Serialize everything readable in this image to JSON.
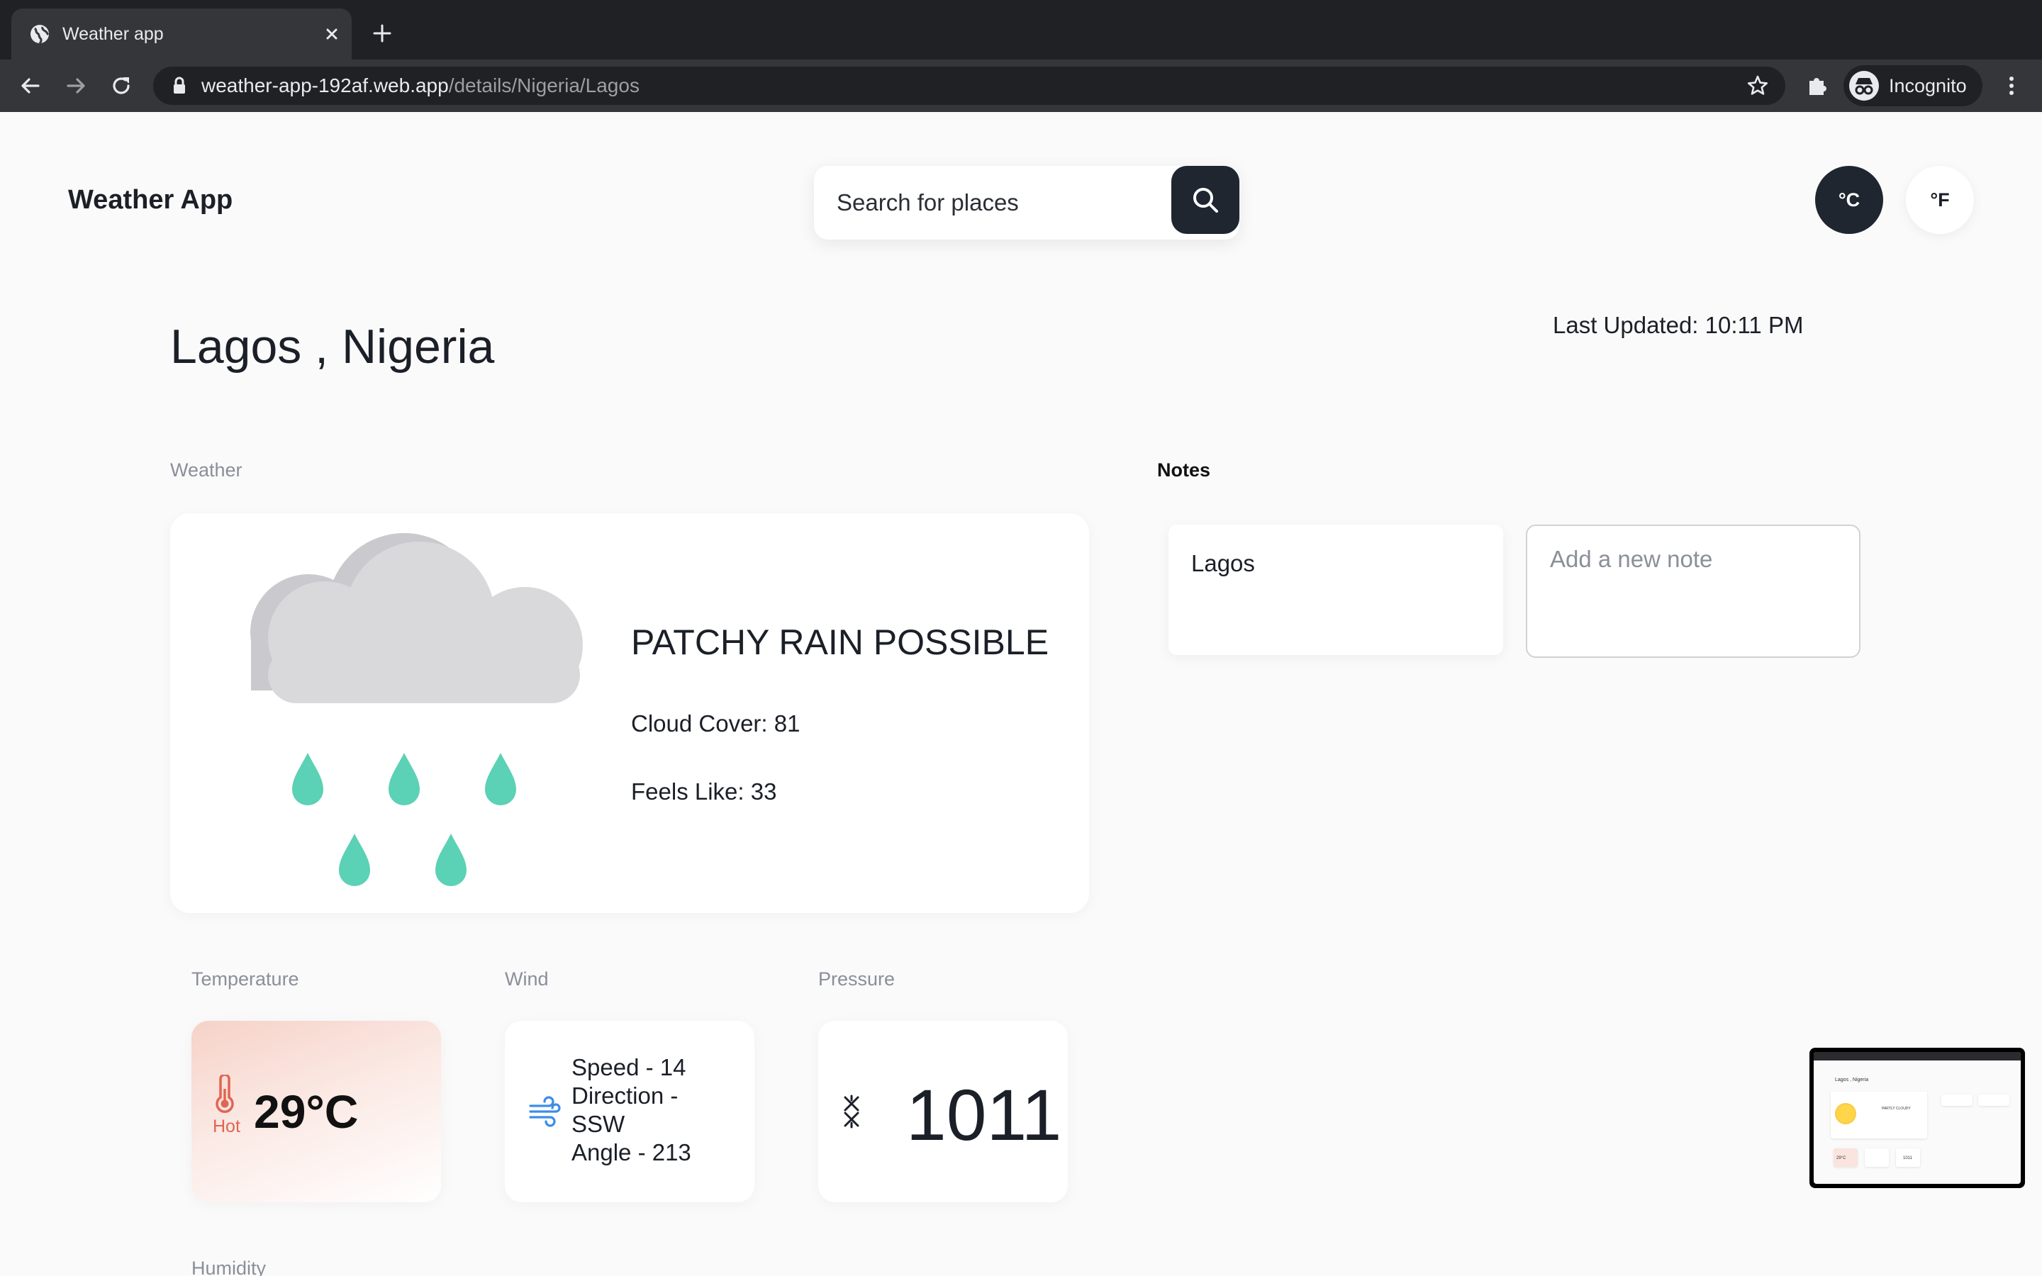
{
  "browser": {
    "tab_title": "Weather app",
    "url_host": "weather-app-192af.web.app",
    "url_path": "/details/Nigeria/Lagos",
    "profile_label": "Incognito"
  },
  "app": {
    "title": "Weather App",
    "search_placeholder": "Search for places",
    "unit_celsius": "°C",
    "unit_fahrenheit": "°F"
  },
  "location": {
    "name": "Lagos , Nigeria",
    "last_updated": "Last Updated: 10:11 PM"
  },
  "weather": {
    "section_label": "Weather",
    "icon": "rain-cloud-icon",
    "condition": "PATCHY RAIN POSSIBLE",
    "cloud_cover": "Cloud Cover: 81",
    "feels_like": "Feels Like: 33"
  },
  "notes": {
    "section_label": "Notes",
    "items": [
      {
        "text": "Lagos"
      }
    ],
    "new_note_placeholder": "Add a new note"
  },
  "stats": {
    "temperature": {
      "label": "Temperature",
      "value": "29°C",
      "descriptor": "Hot",
      "icon": "thermometer-icon"
    },
    "wind": {
      "label": "Wind",
      "lines": [
        "Speed - 14",
        "Direction -",
        "SSW",
        "Angle - 213"
      ],
      "icon": "wind-icon"
    },
    "pressure": {
      "label": "Pressure",
      "value": "1011",
      "icon": "pressure-icon"
    },
    "humidity": {
      "label": "Humidity"
    }
  },
  "thumbnail": {
    "location": "Lagos , Nigeria",
    "condition": "PARTLY CLOUDY",
    "temperature": "29°C",
    "pressure": "1011"
  },
  "colors": {
    "dark": "#1f2630",
    "rain_drop": "#5bd1b5",
    "hot": "#e06552",
    "wind": "#3b8de8"
  }
}
